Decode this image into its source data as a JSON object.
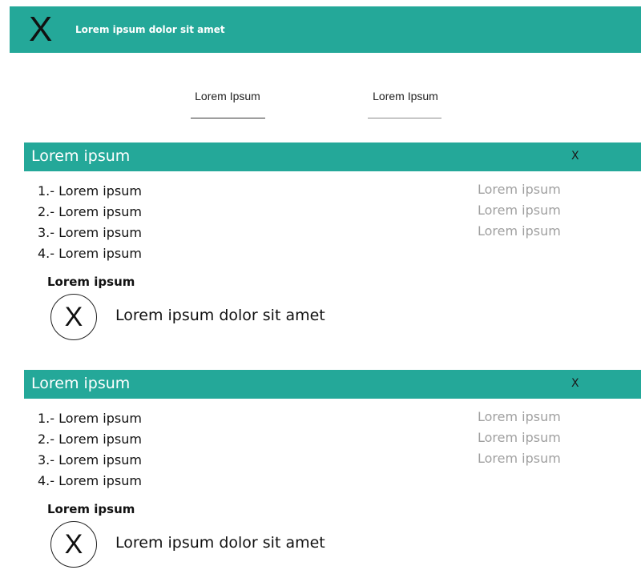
{
  "topbar": {
    "icon": "close-icon",
    "icon_glyph": "X",
    "title": "Lorem ipsum dolor sit amet",
    "color": "#24a899"
  },
  "tabs": [
    {
      "label": "Lorem Ipsum"
    },
    {
      "label": "Lorem Ipsum"
    }
  ],
  "cards": [
    {
      "title": "Lorem ipsum",
      "close_glyph": "X",
      "items": [
        "1.- Lorem ipsum",
        "2.- Lorem ipsum",
        "3.- Lorem ipsum",
        "4.- Lorem ipsum"
      ],
      "side_items": [
        "Lorem ipsum",
        "Lorem ipsum",
        "Lorem ipsum"
      ],
      "section_heading": "Lorem ipsum",
      "circle_icon": "close-circle-icon",
      "circle_glyph": "X",
      "circle_text": "Lorem ipsum dolor sit amet"
    },
    {
      "title": "Lorem ipsum",
      "close_glyph": "X",
      "items": [
        "1.- Lorem ipsum",
        "2.- Lorem ipsum",
        "3.- Lorem ipsum",
        "4.- Lorem ipsum"
      ],
      "side_items": [
        "Lorem ipsum",
        "Lorem ipsum",
        "Lorem ipsum"
      ],
      "section_heading": "Lorem ipsum",
      "circle_icon": "close-circle-icon",
      "circle_glyph": "X",
      "circle_text": "Lorem ipsum dolor sit amet"
    }
  ],
  "colors": {
    "accent": "#24a899",
    "muted_text": "#a0a0a0"
  }
}
